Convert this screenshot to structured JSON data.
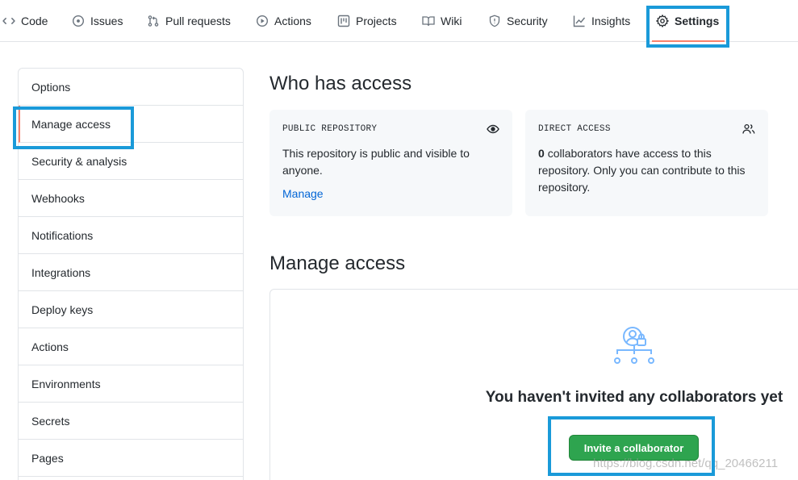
{
  "nav": {
    "tabs": [
      {
        "label": "Code",
        "icon": "code-icon"
      },
      {
        "label": "Issues",
        "icon": "issue-opened-icon"
      },
      {
        "label": "Pull requests",
        "icon": "git-pull-request-icon"
      },
      {
        "label": "Actions",
        "icon": "play-icon"
      },
      {
        "label": "Projects",
        "icon": "project-icon"
      },
      {
        "label": "Wiki",
        "icon": "book-icon"
      },
      {
        "label": "Security",
        "icon": "shield-icon"
      },
      {
        "label": "Insights",
        "icon": "graph-icon"
      },
      {
        "label": "Settings",
        "icon": "gear-icon",
        "selected": true
      }
    ]
  },
  "sidebar": {
    "items": [
      {
        "label": "Options"
      },
      {
        "label": "Manage access",
        "active": true
      },
      {
        "label": "Security & analysis"
      },
      {
        "label": "Webhooks"
      },
      {
        "label": "Notifications"
      },
      {
        "label": "Integrations"
      },
      {
        "label": "Deploy keys"
      },
      {
        "label": "Actions"
      },
      {
        "label": "Environments"
      },
      {
        "label": "Secrets"
      },
      {
        "label": "Pages"
      }
    ]
  },
  "who_has_access": {
    "title": "Who has access",
    "public_card": {
      "label": "PUBLIC REPOSITORY",
      "icon": "eye-icon",
      "text": "This repository is public and visible to anyone.",
      "link": "Manage"
    },
    "direct_card": {
      "label": "DIRECT ACCESS",
      "icon": "people-icon",
      "count": "0",
      "text": "collaborators have access to this repository. Only you can contribute to this repository."
    }
  },
  "manage_access": {
    "title": "Manage access",
    "empty_title": "You haven't invited any collaborators yet",
    "icon": "collaborators-lock-icon",
    "invite_button": "Invite a collaborator"
  },
  "watermark": "https://blog.csdn.net/qq_20466211",
  "colors": {
    "accent_underline": "#f9826c",
    "link": "#0366d6",
    "button_green": "#2ea44f",
    "highlight_box": "#1a9ad9"
  }
}
